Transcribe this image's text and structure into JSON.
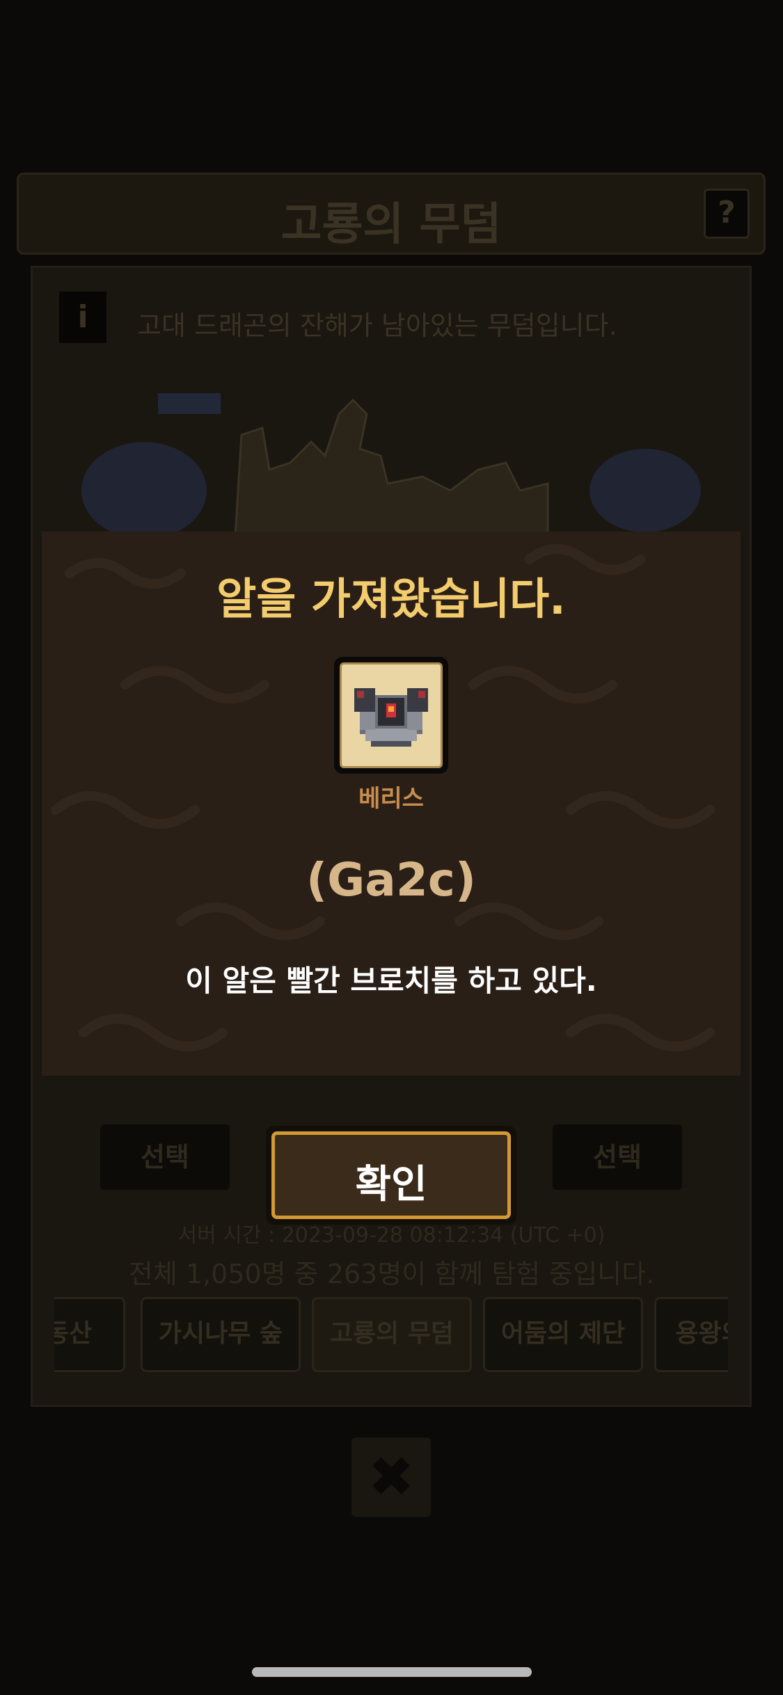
{
  "background": {
    "dungeon_title": "고룡의 무덤",
    "help_label": "?",
    "info_label": "i",
    "dungeon_description": "고대 드래곤의 잔해가 남아있는 무덤입니다.",
    "slots": [
      {
        "select_label": "선택"
      },
      {
        "select_label": ""
      },
      {
        "select_label": "선택"
      }
    ],
    "server_time": "서버 시간 : 2023-09-28 08:12:34 (UTC +0)",
    "total_status": "전체 1,050명 중 263명이 함께 탐험 중입니다.",
    "tabs": [
      {
        "label": "동산"
      },
      {
        "label": "가시나무 숲"
      },
      {
        "label": "고룡의 무덤"
      },
      {
        "label": "어둠의 제단"
      },
      {
        "label": "용왕의"
      }
    ],
    "close_icon": "close-icon"
  },
  "modal": {
    "title": "알을 가져왔습니다.",
    "item": {
      "name": "베리스",
      "code": "(Ga2c)",
      "icon": "armored-egg-icon"
    },
    "description": "이 알은 빨간 브로치를 하고 있다.",
    "confirm_label": "확인"
  },
  "colors": {
    "modal_bg": "#2a1f17",
    "title_gold": "#f3cc6e",
    "item_name": "#c98d4e",
    "item_code": "#d7b78a",
    "confirm_border": "#d39a34"
  }
}
